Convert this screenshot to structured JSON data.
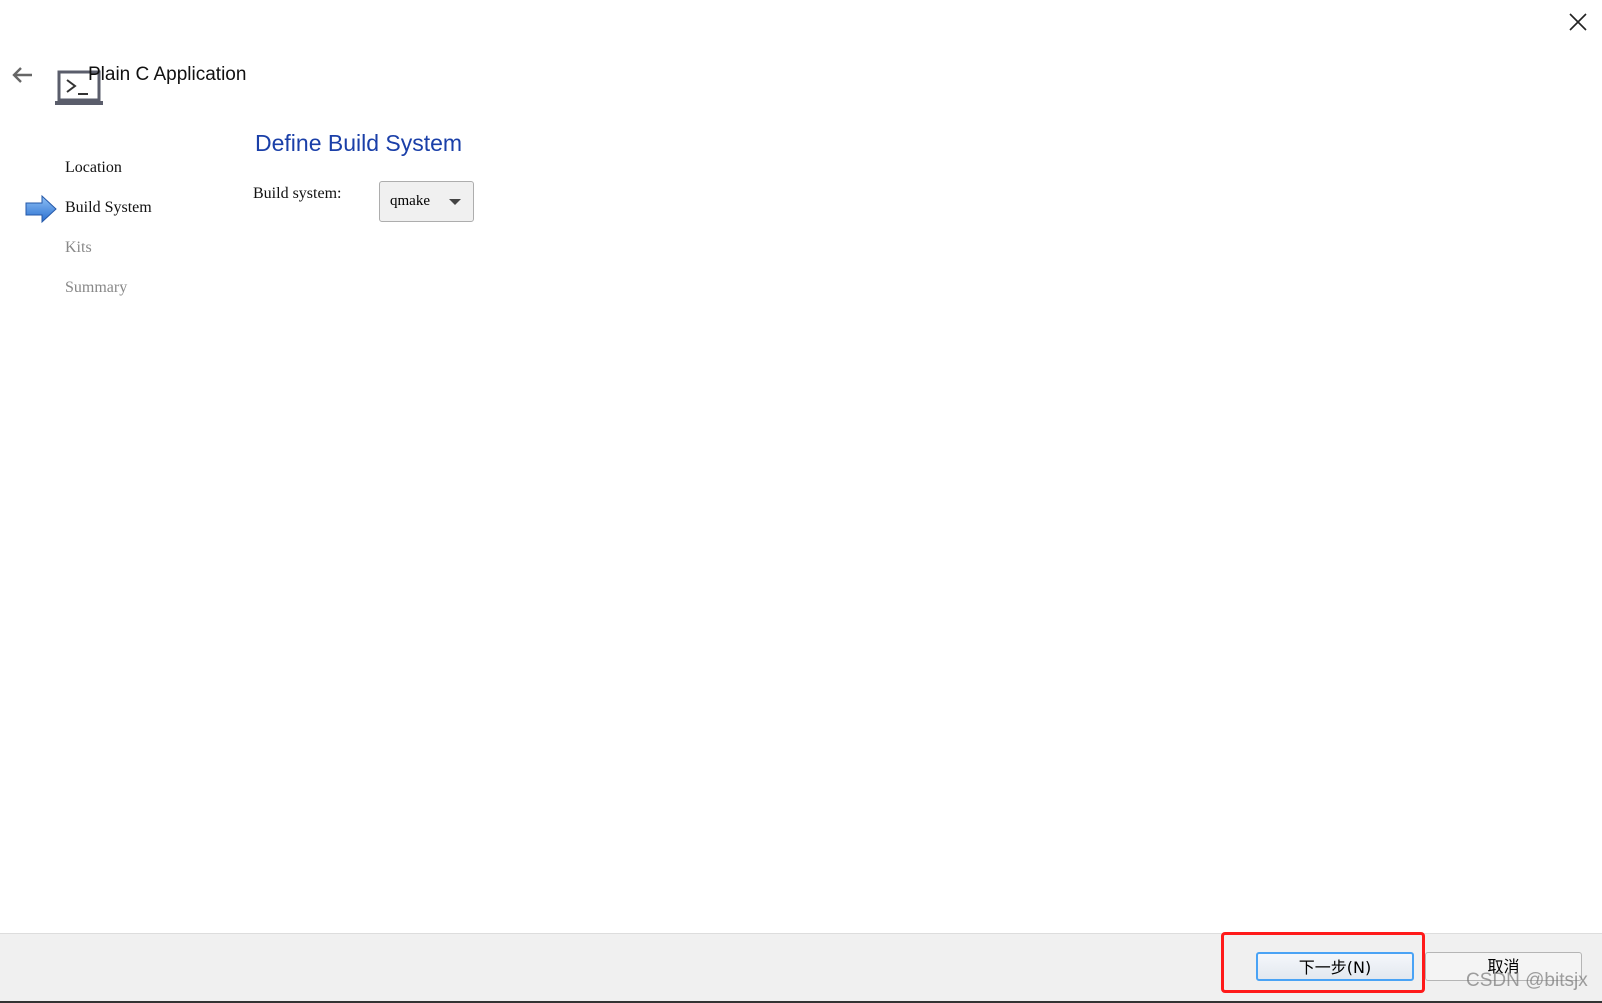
{
  "window": {
    "title": "Plain C Application"
  },
  "icons": {
    "close": "close-icon",
    "back": "back-arrow-icon",
    "app": "terminal-laptop-icon",
    "current_step": "arrow-right-icon"
  },
  "steps": [
    {
      "label": "Location",
      "state": "done"
    },
    {
      "label": "Build System",
      "state": "current"
    },
    {
      "label": "Kits",
      "state": "pending"
    },
    {
      "label": "Summary",
      "state": "pending"
    }
  ],
  "page": {
    "heading": "Define Build System",
    "build_system_label": "Build system:",
    "build_system_value": "qmake"
  },
  "footer": {
    "next_label": "下一步(N)",
    "cancel_label": "取消"
  },
  "watermark": "CSDN @bitsjx",
  "colors": {
    "heading": "#1a3fa8",
    "highlight": "#ff1a1a",
    "pending_step": "#888888"
  }
}
